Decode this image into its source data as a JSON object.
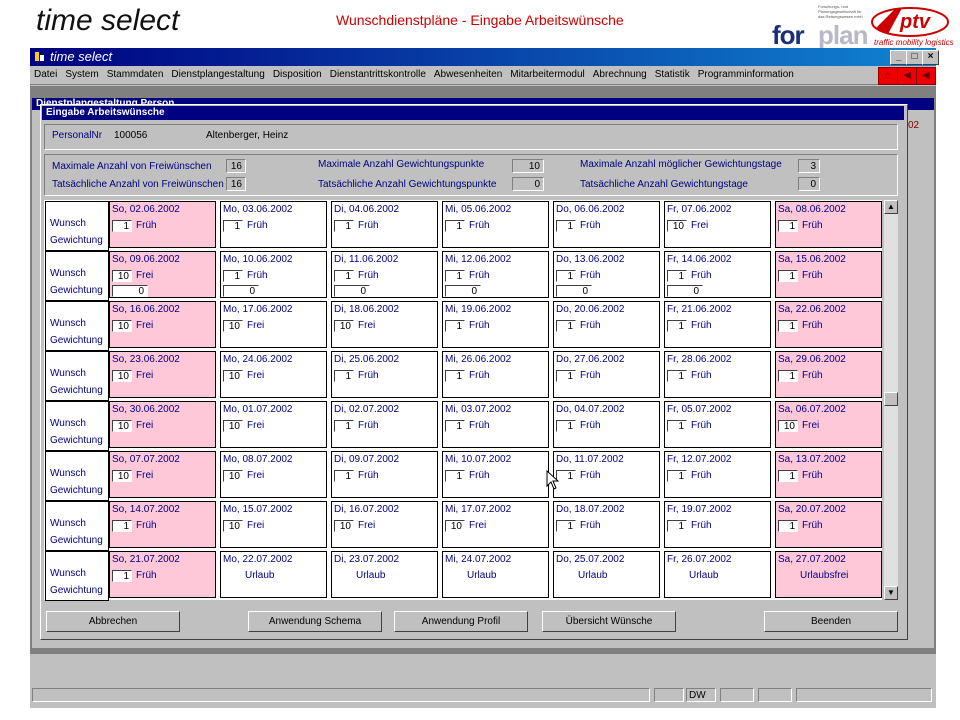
{
  "slide": {
    "title": "time select",
    "subtitle": "Wunschdienstpläne - Eingabe Arbeitswünsche",
    "logo_forplan_a": "for",
    "logo_forplan_b": "plan",
    "logo_ptv_tag": "traffic mobility logistics",
    "logo_small_text": "Forschungs- und Planungsgesellschaft für das Rettungswesen mbH"
  },
  "app": {
    "title": "time select",
    "menu": [
      "Datei",
      "System",
      "Stammdaten",
      "Dienstplangestaltung",
      "Disposition",
      "Dienstantrittskontrolle",
      "Abwesenheiten",
      "Mitarbeitermodul",
      "Abrechnung",
      "Statistik",
      "Programminformation"
    ],
    "bg_window_title": "Dienstplangestaltung Person",
    "bg_right_label": "02"
  },
  "dialog": {
    "title": "Eingabe Arbeitswünsche",
    "personal_label": "PersonalNr",
    "personal_nr": "100056",
    "person_name": "Altenberger, Heinz",
    "stats": {
      "max_frei_label": "Maximale Anzahl von Freiwünschen",
      "max_frei": "16",
      "act_frei_label": "Tatsächliche Anzahl von Freiwünschen",
      "act_frei": "16",
      "max_gew_label": "Maximale Anzahl Gewichtungspunkte",
      "max_gew": "10",
      "act_gew_label": "Tatsächliche Anzahl Gewichtungspunkte",
      "act_gew": "0",
      "max_tage_label": "Maximale Anzahl möglicher Gewichtungstage",
      "max_tage": "3",
      "act_tage_label": "Tatsächliche Anzahl Gewichtungstage",
      "act_tage": "0"
    },
    "row_label_wunsch": "Wunsch",
    "row_label_gewichtung": "Gewichtung",
    "weeks": [
      [
        {
          "date": "So, 02.06.2002",
          "w": "1",
          "s": "Früh",
          "g": ""
        },
        {
          "date": "Mo, 03.06.2002",
          "w": "1",
          "s": "Früh",
          "g": ""
        },
        {
          "date": "Di, 04.06.2002",
          "w": "1",
          "s": "Früh",
          "g": ""
        },
        {
          "date": "Mi, 05.06.2002",
          "w": "1",
          "s": "Früh",
          "g": ""
        },
        {
          "date": "Do, 06.06.2002",
          "w": "1",
          "s": "Früh",
          "g": ""
        },
        {
          "date": "Fr, 07.06.2002",
          "w": "10",
          "s": "Frei",
          "g": ""
        },
        {
          "date": "Sa, 08.06.2002",
          "w": "1",
          "s": "Früh",
          "g": ""
        }
      ],
      [
        {
          "date": "So, 09.06.2002",
          "w": "10",
          "s": "Frei",
          "g": "0"
        },
        {
          "date": "Mo, 10.06.2002",
          "w": "1",
          "s": "Früh",
          "g": "0"
        },
        {
          "date": "Di, 11.06.2002",
          "w": "1",
          "s": "Früh",
          "g": "0"
        },
        {
          "date": "Mi, 12.06.2002",
          "w": "1",
          "s": "Früh",
          "g": "0"
        },
        {
          "date": "Do, 13.06.2002",
          "w": "1",
          "s": "Früh",
          "g": "0"
        },
        {
          "date": "Fr, 14.06.2002",
          "w": "1",
          "s": "Früh",
          "g": "0"
        },
        {
          "date": "Sa, 15.06.2002",
          "w": "1",
          "s": "Früh",
          "g": ""
        }
      ],
      [
        {
          "date": "So, 16.06.2002",
          "w": "10",
          "s": "Frei",
          "g": ""
        },
        {
          "date": "Mo, 17.06.2002",
          "w": "10",
          "s": "Frei",
          "g": ""
        },
        {
          "date": "Di, 18.06.2002",
          "w": "10",
          "s": "Frei",
          "g": ""
        },
        {
          "date": "Mi, 19.06.2002",
          "w": "1",
          "s": "Früh",
          "g": ""
        },
        {
          "date": "Do, 20.06.2002",
          "w": "1",
          "s": "Früh",
          "g": ""
        },
        {
          "date": "Fr, 21.06.2002",
          "w": "1",
          "s": "Früh",
          "g": ""
        },
        {
          "date": "Sa, 22.06.2002",
          "w": "1",
          "s": "Früh",
          "g": ""
        }
      ],
      [
        {
          "date": "So, 23.06.2002",
          "w": "10",
          "s": "Frei",
          "g": ""
        },
        {
          "date": "Mo, 24.06.2002",
          "w": "10",
          "s": "Frei",
          "g": ""
        },
        {
          "date": "Di, 25.06.2002",
          "w": "1",
          "s": "Früh",
          "g": ""
        },
        {
          "date": "Mi, 26.06.2002",
          "w": "1",
          "s": "Früh",
          "g": ""
        },
        {
          "date": "Do, 27.06.2002",
          "w": "1",
          "s": "Früh",
          "g": ""
        },
        {
          "date": "Fr, 28.06.2002",
          "w": "1",
          "s": "Früh",
          "g": ""
        },
        {
          "date": "Sa, 29.06.2002",
          "w": "1",
          "s": "Früh",
          "g": ""
        }
      ],
      [
        {
          "date": "So, 30.06.2002",
          "w": "10",
          "s": "Frei",
          "g": ""
        },
        {
          "date": "Mo, 01.07.2002",
          "w": "10",
          "s": "Frei",
          "g": ""
        },
        {
          "date": "Di, 02.07.2002",
          "w": "1",
          "s": "Früh",
          "g": ""
        },
        {
          "date": "Mi, 03.07.2002",
          "w": "1",
          "s": "Früh",
          "g": ""
        },
        {
          "date": "Do, 04.07.2002",
          "w": "1",
          "s": "Früh",
          "g": ""
        },
        {
          "date": "Fr, 05.07.2002",
          "w": "1",
          "s": "Früh",
          "g": ""
        },
        {
          "date": "Sa, 06.07.2002",
          "w": "10",
          "s": "Frei",
          "g": ""
        }
      ],
      [
        {
          "date": "So, 07.07.2002",
          "w": "10",
          "s": "Frei",
          "g": ""
        },
        {
          "date": "Mo, 08.07.2002",
          "w": "10",
          "s": "Frei",
          "g": ""
        },
        {
          "date": "Di, 09.07.2002",
          "w": "1",
          "s": "Früh",
          "g": ""
        },
        {
          "date": "Mi, 10.07.2002",
          "w": "1",
          "s": "Früh",
          "g": ""
        },
        {
          "date": "Do, 11.07.2002",
          "w": "1",
          "s": "Früh",
          "g": ""
        },
        {
          "date": "Fr, 12.07.2002",
          "w": "1",
          "s": "Früh",
          "g": ""
        },
        {
          "date": "Sa, 13.07.2002",
          "w": "1",
          "s": "Früh",
          "g": ""
        }
      ],
      [
        {
          "date": "So, 14.07.2002",
          "w": "1",
          "s": "Früh",
          "g": ""
        },
        {
          "date": "Mo, 15.07.2002",
          "w": "10",
          "s": "Frei",
          "g": ""
        },
        {
          "date": "Di, 16.07.2002",
          "w": "10",
          "s": "Frei",
          "g": ""
        },
        {
          "date": "Mi, 17.07.2002",
          "w": "10",
          "s": "Frei",
          "g": ""
        },
        {
          "date": "Do, 18.07.2002",
          "w": "1",
          "s": "Früh",
          "g": ""
        },
        {
          "date": "Fr, 19.07.2002",
          "w": "1",
          "s": "Früh",
          "g": ""
        },
        {
          "date": "Sa, 20.07.2002",
          "w": "1",
          "s": "Früh",
          "g": ""
        }
      ],
      [
        {
          "date": "So, 21.07.2002",
          "w": "1",
          "s": "Früh",
          "g": ""
        },
        {
          "date": "Mo, 22.07.2002",
          "w": "",
          "s": "Urlaub",
          "g": ""
        },
        {
          "date": "Di, 23.07.2002",
          "w": "",
          "s": "Urlaub",
          "g": ""
        },
        {
          "date": "Mi, 24.07.2002",
          "w": "",
          "s": "Urlaub",
          "g": ""
        },
        {
          "date": "Do, 25.07.2002",
          "w": "",
          "s": "Urlaub",
          "g": ""
        },
        {
          "date": "Fr, 26.07.2002",
          "w": "",
          "s": "Urlaub",
          "g": ""
        },
        {
          "date": "Sa, 27.07.2002",
          "w": "",
          "s": "Urlaubsfrei",
          "g": ""
        }
      ]
    ],
    "buttons": {
      "abbrechen": "Abbrechen",
      "schema": "Anwendung Schema",
      "profil": "Anwendung Profil",
      "uebersicht": "Übersicht Wünsche",
      "beenden": "Beenden"
    }
  },
  "statusbar": {
    "user": "DW"
  },
  "colors": {
    "weekend_cell": "#ffc8d8",
    "label_blue": "#000080",
    "titlebar": "#000080"
  }
}
